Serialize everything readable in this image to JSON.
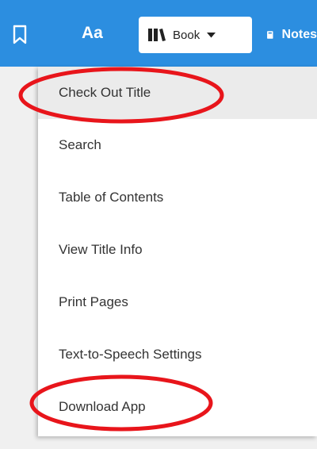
{
  "toolbar": {
    "bookmark_icon": "bookmark-icon",
    "aa_label": "Aa",
    "book_label": "Book",
    "book_icon": "book-icon",
    "notes_label": "Notes",
    "notes_icon": "notebook-icon",
    "background_color": "#2c8ee0"
  },
  "menu": {
    "items": [
      {
        "label": "Check Out Title",
        "highlighted": true
      },
      {
        "label": "Search"
      },
      {
        "label": "Table of Contents"
      },
      {
        "label": "View Title Info"
      },
      {
        "label": "Print Pages"
      },
      {
        "label": "Text-to-Speech Settings"
      },
      {
        "label": "Download App"
      }
    ]
  },
  "annotations": {
    "circled_items": [
      "Check Out Title",
      "Download App"
    ],
    "circle_color": "#e8151b"
  }
}
